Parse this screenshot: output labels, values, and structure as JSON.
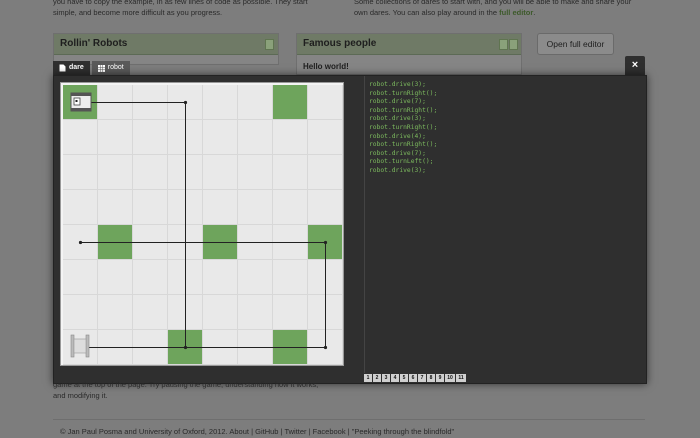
{
  "background": {
    "intro_left": "you have to copy the example, in as few lines of code as possible. They start simple, and become more difficult as you progress.",
    "intro_right_prefix": "Some collections of dares to start with, and you will be able to make and share your own dares. You can also play around in the",
    "intro_right_link": "full editor",
    "intro_right_suffix": ".",
    "panel_left_title": "Rollin' Robots",
    "panel_right_title": "Famous people",
    "panel_right_text": "Hello world!",
    "full_editor_button": "Open full editor",
    "below_text": "game at the top of the page. Try pausing the game, understanding how it works, and modifying it."
  },
  "modal": {
    "tabs": [
      {
        "label": "dare",
        "icon": "document-icon",
        "active": true
      },
      {
        "label": "robot",
        "icon": "grid-icon",
        "active": false
      }
    ],
    "close_label": "×",
    "code_lines": [
      "robot.drive(3);",
      "robot.turnRight();",
      "robot.drive(7);",
      "robot.turnRight();",
      "robot.drive(3);",
      "robot.turnRight();",
      "robot.drive(4);",
      "robot.turnRight();",
      "robot.drive(7);",
      "robot.turnLeft();",
      "robot.drive(3);"
    ],
    "pages": [
      "1",
      "2",
      "3",
      "4",
      "5",
      "6",
      "7",
      "8",
      "9",
      "10",
      "11"
    ]
  },
  "board": {
    "size": 8,
    "green_cells": [
      [
        0,
        0
      ],
      [
        6,
        0
      ],
      [
        1,
        4
      ],
      [
        4,
        4
      ],
      [
        7,
        4
      ],
      [
        3,
        7
      ],
      [
        6,
        7
      ]
    ],
    "colors": {
      "green": "#6ea45c",
      "code": "#7cba5e"
    }
  },
  "footer": {
    "copyright": "© Jan Paul Posma and University of Oxford, 2012.",
    "links": [
      "About",
      "GitHub",
      "Twitter",
      "Facebook",
      "\"Peeking through the blindfold\""
    ]
  }
}
